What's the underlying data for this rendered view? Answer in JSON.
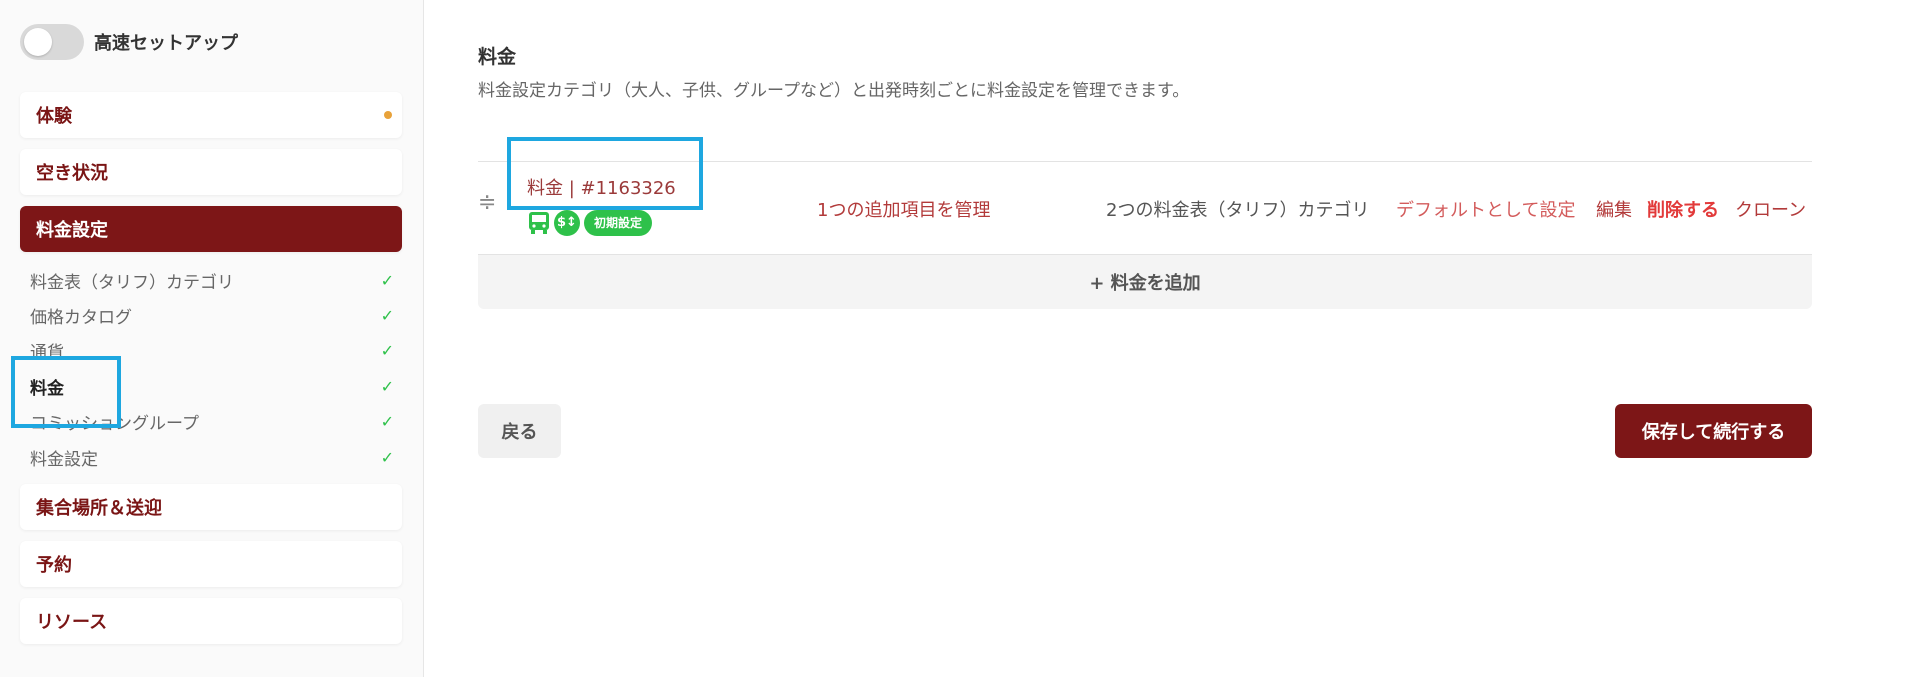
{
  "setup": {
    "toggle_label": "高速セットアップ"
  },
  "sidebar": {
    "sections": {
      "experience": "体験",
      "availability": "空き状況",
      "pricing_settings": "料金設定",
      "meeting_transfer": "集合場所＆送迎",
      "booking": "予約",
      "resources": "リソース"
    },
    "subitems": [
      {
        "label": "料金表（タリフ）カテゴリ",
        "check": "✓"
      },
      {
        "label": "価格カタログ",
        "check": "✓"
      },
      {
        "label": "通貨",
        "check": "✓"
      },
      {
        "label": "料金",
        "check": "✓"
      },
      {
        "label": "コミッショングループ",
        "check": "✓"
      },
      {
        "label": "料金設定",
        "check": "✓"
      }
    ]
  },
  "main": {
    "title": "料金",
    "description": "料金設定カテゴリ（大人、子供、グループなど）と出発時刻ごとに料金設定を管理できます。",
    "price_item": {
      "name": "料金 | #1163326",
      "badge_initial": "初期設定",
      "addon_link": "1つの追加項目を管理",
      "tariff_text": "2つの料金表（タリフ）カテゴリ",
      "default_link": "デフォルトとして設定",
      "edit_link": "編集",
      "delete_link": "削除する",
      "clone_link": "クローン"
    },
    "add_price_label": "+ 料金を追加",
    "back_label": "戻る",
    "save_label": "保存して続行する"
  },
  "colors": {
    "accent": "#7d1617",
    "success": "#2ec14a",
    "highlight": "#1ea7e0",
    "link": "#b23a3a"
  },
  "icons": {
    "drag": "drag-handle-icon",
    "bus": "bus-icon",
    "money": "money-icon"
  }
}
